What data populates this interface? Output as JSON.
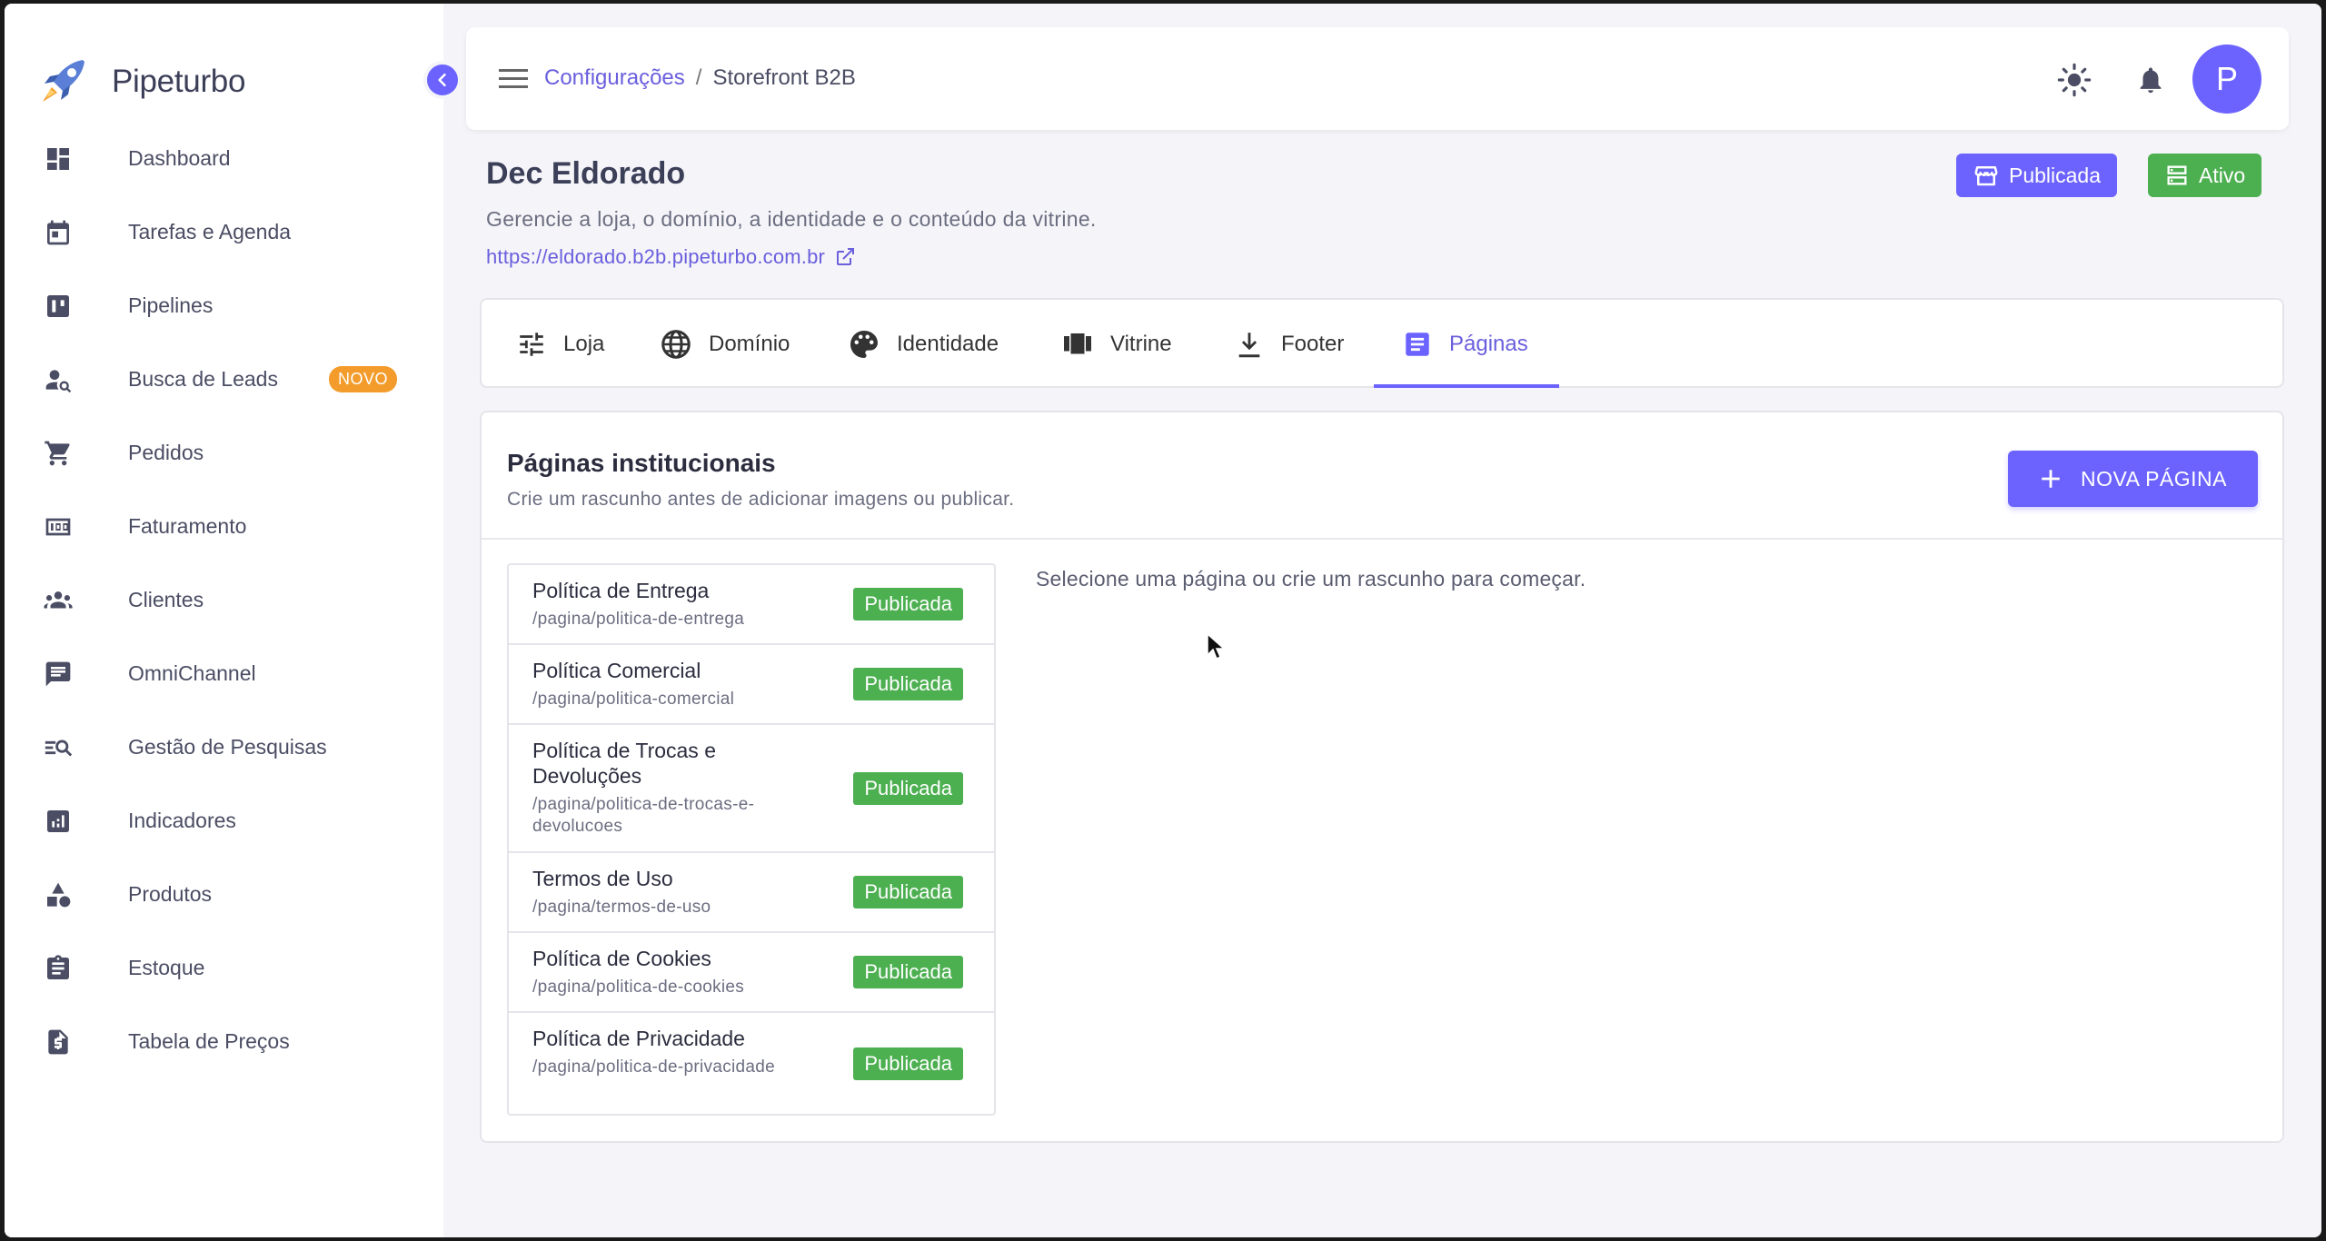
{
  "app": {
    "name": "Pipeturbo"
  },
  "colors": {
    "accent": "#6c63ff",
    "success": "#4caf50",
    "badge": "#f39c2b"
  },
  "sidebar": {
    "items": [
      {
        "label": "Dashboard",
        "icon": "dashboard-icon"
      },
      {
        "label": "Tarefas e Agenda",
        "icon": "calendar-icon"
      },
      {
        "label": "Pipelines",
        "icon": "kanban-icon"
      },
      {
        "label": "Busca de Leads",
        "icon": "person-search-icon",
        "badge": "NOVO"
      },
      {
        "label": "Pedidos",
        "icon": "cart-icon"
      },
      {
        "label": "Faturamento",
        "icon": "invoice-icon"
      },
      {
        "label": "Clientes",
        "icon": "group-icon"
      },
      {
        "label": "OmniChannel",
        "icon": "chat-icon"
      },
      {
        "label": "Gestão de Pesquisas",
        "icon": "survey-icon"
      },
      {
        "label": "Indicadores",
        "icon": "analytics-icon"
      },
      {
        "label": "Produtos",
        "icon": "category-icon"
      },
      {
        "label": "Estoque",
        "icon": "clipboard-icon"
      },
      {
        "label": "Tabela de Preços",
        "icon": "price-doc-icon"
      }
    ]
  },
  "topbar": {
    "breadcrumb": {
      "parent": "Configurações",
      "separator": "/",
      "current": "Storefront B2B"
    },
    "avatar_initial": "P"
  },
  "header": {
    "title": "Dec Eldorado",
    "subtitle": "Gerencie a loja, o domínio, a identidade e o conteúdo da vitrine.",
    "url": "https://eldorado.b2b.pipeturbo.com.br",
    "status_published": "Publicada",
    "status_active": "Ativo"
  },
  "tabs": [
    {
      "label": "Loja"
    },
    {
      "label": "Domínio"
    },
    {
      "label": "Identidade"
    },
    {
      "label": "Vitrine"
    },
    {
      "label": "Footer"
    },
    {
      "label": "Páginas",
      "active": true
    }
  ],
  "pages_card": {
    "title": "Páginas institucionais",
    "subtitle": "Crie um rascunho antes de adicionar imagens ou publicar.",
    "new_button": "NOVA PÁGINA",
    "empty_message": "Selecione uma página ou crie um rascunho para começar.",
    "pages": [
      {
        "title": "Política de Entrega",
        "slug": "/pagina/politica-de-entrega",
        "status": "Publicada"
      },
      {
        "title": "Política Comercial",
        "slug": "/pagina/politica-comercial",
        "status": "Publicada"
      },
      {
        "title": "Política de Trocas e Devoluções",
        "slug": "/pagina/politica-de-trocas-e-devolucoes",
        "status": "Publicada"
      },
      {
        "title": "Termos de Uso",
        "slug": "/pagina/termos-de-uso",
        "status": "Publicada"
      },
      {
        "title": "Política de Cookies",
        "slug": "/pagina/politica-de-cookies",
        "status": "Publicada"
      },
      {
        "title": "Política de Privacidade",
        "slug": "/pagina/politica-de-privacidade",
        "status": "Publicada"
      }
    ]
  }
}
